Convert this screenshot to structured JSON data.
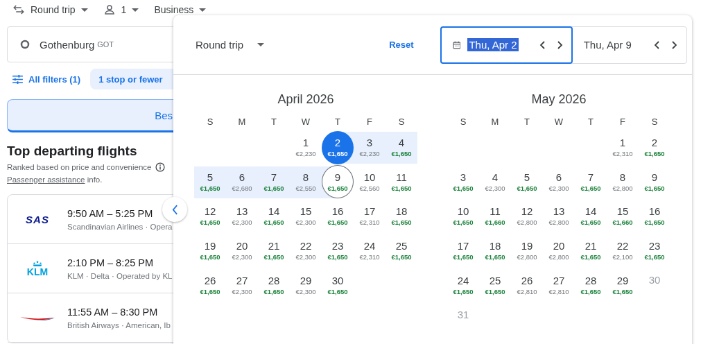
{
  "top_bar": {
    "trip_type": "Round trip",
    "passengers": "1",
    "cabin": "Business"
  },
  "origin": {
    "city": "Gothenburg",
    "code": "GOT"
  },
  "filters": {
    "all_filters": "All filters (1)",
    "chip": "1 stop or fewer"
  },
  "tab": {
    "label": "Bes",
    "selected": true
  },
  "results": {
    "title": "Top departing flights",
    "subtitle": "Ranked based on price and convenience",
    "assist_link": "Passenger assistance",
    "assist_rest": " info."
  },
  "flights": [
    {
      "kind": "sas",
      "logo_text": "SAS",
      "times": "9:50 AM – 5:25 PM",
      "airlines": "Scandinavian Airlines · Opera"
    },
    {
      "kind": "klm",
      "logo_text": "KLM",
      "times": "2:10 PM – 8:25 PM",
      "airlines": "KLM · Delta · Operated by KL"
    },
    {
      "kind": "ba",
      "times": "11:55 AM – 8:30 PM",
      "airlines": "British Airways · American, Ib"
    }
  ],
  "picker": {
    "trip_type": "Round trip",
    "reset": "Reset",
    "dates": [
      {
        "value": "Thu, Apr 2",
        "focused": true,
        "calendar_icon": true
      },
      {
        "value": "Thu, Apr 9",
        "focused": false,
        "calendar_icon": false
      }
    ],
    "months": [
      {
        "title": "April 2026",
        "weekdays": [
          "S",
          "M",
          "T",
          "W",
          "T",
          "F",
          "S"
        ],
        "weeks": [
          {
            "right_aligned": true,
            "days": [
              {
                "day": "1",
                "price": "€2,230",
                "cheap": false,
                "disabled": false,
                "kind": "plain"
              },
              {
                "day": "2",
                "price": "€1,650",
                "cheap": true,
                "disabled": false,
                "kind": "range_start"
              },
              {
                "day": "3",
                "price": "€2,230",
                "cheap": false,
                "disabled": false,
                "kind": "in_range"
              },
              {
                "day": "4",
                "price": "€1,650",
                "cheap": true,
                "disabled": false,
                "kind": "in_range"
              }
            ]
          },
          {
            "days": [
              {
                "day": "5",
                "price": "€1,650",
                "cheap": true,
                "disabled": false,
                "kind": "in_range"
              },
              {
                "day": "6",
                "price": "€2,680",
                "cheap": false,
                "disabled": false,
                "kind": "in_range"
              },
              {
                "day": "7",
                "price": "€1,650",
                "cheap": true,
                "disabled": false,
                "kind": "in_range"
              },
              {
                "day": "8",
                "price": "€2,550",
                "cheap": false,
                "disabled": false,
                "kind": "in_range"
              },
              {
                "day": "9",
                "price": "€1,650",
                "cheap": true,
                "disabled": false,
                "kind": "range_end"
              },
              {
                "day": "10",
                "price": "€2,560",
                "cheap": false,
                "disabled": false,
                "kind": "plain"
              },
              {
                "day": "11",
                "price": "€1,650",
                "cheap": true,
                "disabled": false,
                "kind": "plain"
              }
            ]
          },
          {
            "days": [
              {
                "day": "12",
                "price": "€1,650",
                "cheap": true,
                "disabled": false,
                "kind": "plain"
              },
              {
                "day": "13",
                "price": "€2,300",
                "cheap": false,
                "disabled": false,
                "kind": "plain"
              },
              {
                "day": "14",
                "price": "€1,650",
                "cheap": true,
                "disabled": false,
                "kind": "plain"
              },
              {
                "day": "15",
                "price": "€2,300",
                "cheap": false,
                "disabled": false,
                "kind": "plain"
              },
              {
                "day": "16",
                "price": "€1,650",
                "cheap": true,
                "disabled": false,
                "kind": "plain"
              },
              {
                "day": "17",
                "price": "€2,310",
                "cheap": false,
                "disabled": false,
                "kind": "plain"
              },
              {
                "day": "18",
                "price": "€1,650",
                "cheap": true,
                "disabled": false,
                "kind": "plain"
              }
            ]
          },
          {
            "days": [
              {
                "day": "19",
                "price": "€1,650",
                "cheap": true,
                "disabled": false,
                "kind": "plain"
              },
              {
                "day": "20",
                "price": "€2,300",
                "cheap": false,
                "disabled": false,
                "kind": "plain"
              },
              {
                "day": "21",
                "price": "€1,650",
                "cheap": true,
                "disabled": false,
                "kind": "plain"
              },
              {
                "day": "22",
                "price": "€2,300",
                "cheap": false,
                "disabled": false,
                "kind": "plain"
              },
              {
                "day": "23",
                "price": "€1,650",
                "cheap": true,
                "disabled": false,
                "kind": "plain"
              },
              {
                "day": "24",
                "price": "€2,310",
                "cheap": false,
                "disabled": false,
                "kind": "plain"
              },
              {
                "day": "25",
                "price": "€1,650",
                "cheap": true,
                "disabled": false,
                "kind": "plain"
              }
            ]
          },
          {
            "right_aligned": false,
            "days": [
              {
                "day": "26",
                "price": "€1,650",
                "cheap": true,
                "disabled": false,
                "kind": "plain"
              },
              {
                "day": "27",
                "price": "€2,300",
                "cheap": false,
                "disabled": false,
                "kind": "plain"
              },
              {
                "day": "28",
                "price": "€1,650",
                "cheap": true,
                "disabled": false,
                "kind": "plain"
              },
              {
                "day": "29",
                "price": "€2,300",
                "cheap": false,
                "disabled": false,
                "kind": "plain"
              },
              {
                "day": "30",
                "price": "€1,650",
                "cheap": true,
                "disabled": false,
                "kind": "plain"
              }
            ]
          }
        ]
      },
      {
        "title": "May 2026",
        "weekdays": [
          "S",
          "M",
          "T",
          "W",
          "T",
          "F",
          "S"
        ],
        "weeks": [
          {
            "right_aligned": true,
            "days": [
              {
                "day": "1",
                "price": "€2,310",
                "cheap": false,
                "disabled": false,
                "kind": "plain"
              },
              {
                "day": "2",
                "price": "€1,650",
                "cheap": true,
                "disabled": false,
                "kind": "plain"
              }
            ]
          },
          {
            "days": [
              {
                "day": "3",
                "price": "€1,650",
                "cheap": true,
                "disabled": false,
                "kind": "plain"
              },
              {
                "day": "4",
                "price": "€2,300",
                "cheap": false,
                "disabled": false,
                "kind": "plain"
              },
              {
                "day": "5",
                "price": "€1,650",
                "cheap": true,
                "disabled": false,
                "kind": "plain"
              },
              {
                "day": "6",
                "price": "€2,300",
                "cheap": false,
                "disabled": false,
                "kind": "plain"
              },
              {
                "day": "7",
                "price": "€1,650",
                "cheap": true,
                "disabled": false,
                "kind": "plain"
              },
              {
                "day": "8",
                "price": "€2,800",
                "cheap": false,
                "disabled": false,
                "kind": "plain"
              },
              {
                "day": "9",
                "price": "€1,650",
                "cheap": true,
                "disabled": false,
                "kind": "plain"
              }
            ]
          },
          {
            "days": [
              {
                "day": "10",
                "price": "€1,650",
                "cheap": true,
                "disabled": false,
                "kind": "plain"
              },
              {
                "day": "11",
                "price": "€1,660",
                "cheap": true,
                "disabled": false,
                "kind": "plain"
              },
              {
                "day": "12",
                "price": "€2,800",
                "cheap": false,
                "disabled": false,
                "kind": "plain"
              },
              {
                "day": "13",
                "price": "€2,800",
                "cheap": false,
                "disabled": false,
                "kind": "plain"
              },
              {
                "day": "14",
                "price": "€1,650",
                "cheap": true,
                "disabled": false,
                "kind": "plain"
              },
              {
                "day": "15",
                "price": "€1,660",
                "cheap": true,
                "disabled": false,
                "kind": "plain"
              },
              {
                "day": "16",
                "price": "€1,650",
                "cheap": true,
                "disabled": false,
                "kind": "plain"
              }
            ]
          },
          {
            "days": [
              {
                "day": "17",
                "price": "€1,650",
                "cheap": true,
                "disabled": false,
                "kind": "plain"
              },
              {
                "day": "18",
                "price": "€1,650",
                "cheap": true,
                "disabled": false,
                "kind": "plain"
              },
              {
                "day": "19",
                "price": "€2,800",
                "cheap": false,
                "disabled": false,
                "kind": "plain"
              },
              {
                "day": "20",
                "price": "€2,800",
                "cheap": false,
                "disabled": false,
                "kind": "plain"
              },
              {
                "day": "21",
                "price": "€1,650",
                "cheap": true,
                "disabled": false,
                "kind": "plain"
              },
              {
                "day": "22",
                "price": "€2,100",
                "cheap": false,
                "disabled": false,
                "kind": "plain"
              },
              {
                "day": "23",
                "price": "€1,650",
                "cheap": true,
                "disabled": false,
                "kind": "plain"
              }
            ]
          },
          {
            "right_aligned": false,
            "days": [
              {
                "day": "24",
                "price": "€1,650",
                "cheap": true,
                "disabled": false,
                "kind": "plain"
              },
              {
                "day": "25",
                "price": "€1,650",
                "cheap": true,
                "disabled": false,
                "kind": "plain"
              },
              {
                "day": "26",
                "price": "€2,810",
                "cheap": false,
                "disabled": false,
                "kind": "plain"
              },
              {
                "day": "27",
                "price": "€2,810",
                "cheap": false,
                "disabled": false,
                "kind": "plain"
              },
              {
                "day": "28",
                "price": "€1,650",
                "cheap": true,
                "disabled": false,
                "kind": "plain"
              },
              {
                "day": "29",
                "price": "€1,650",
                "cheap": true,
                "disabled": false,
                "kind": "plain"
              },
              {
                "day": "30",
                "disabled": true,
                "kind": "plain"
              }
            ]
          },
          {
            "right_aligned": false,
            "days": [
              {
                "day": "31",
                "disabled": true,
                "kind": "plain"
              }
            ]
          }
        ]
      }
    ]
  }
}
